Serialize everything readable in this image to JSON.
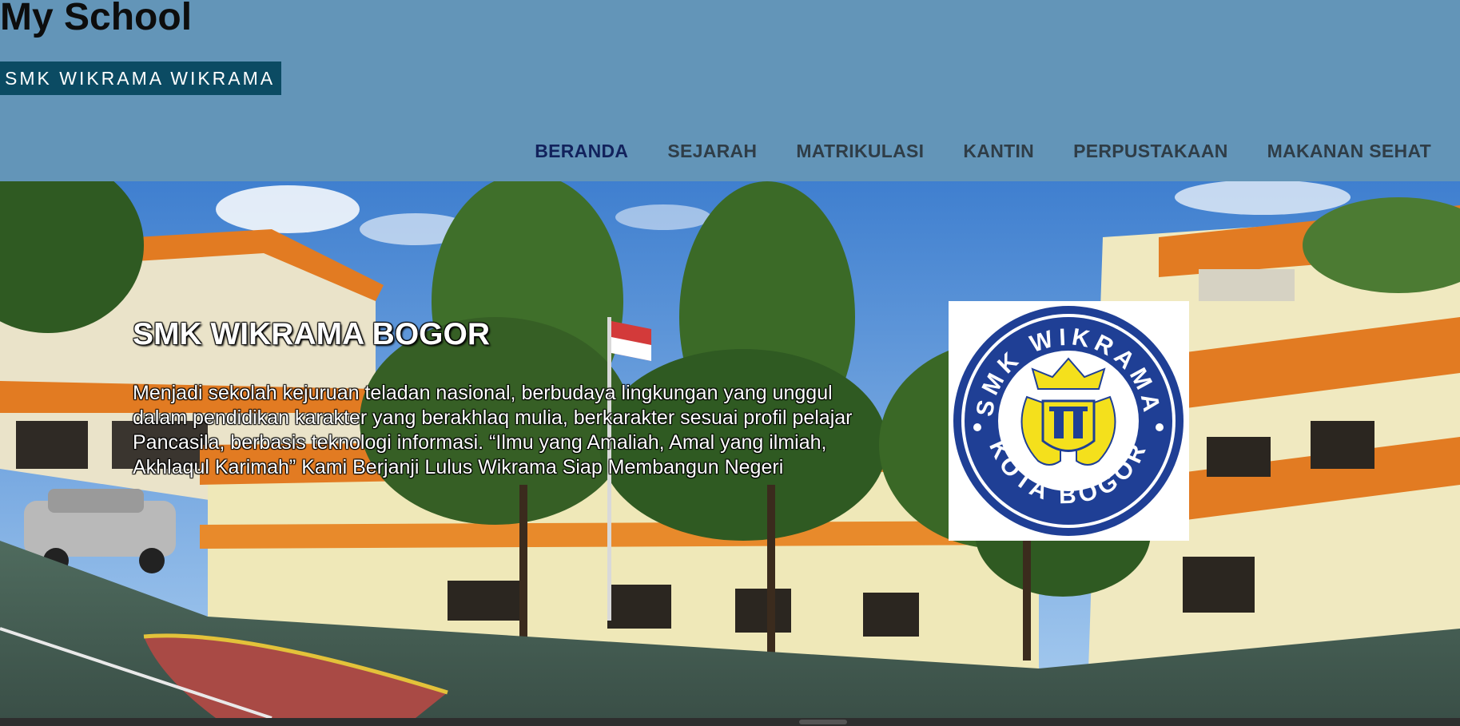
{
  "site": {
    "title": "My School",
    "badge": "SMK WIKRAMA WIKRAMA"
  },
  "nav": {
    "items": [
      {
        "label": "BERANDA",
        "active": true
      },
      {
        "label": "SEJARAH"
      },
      {
        "label": "MATRIKULASI"
      },
      {
        "label": "KANTIN"
      },
      {
        "label": "PERPUSTAKAAN"
      },
      {
        "label": "MAKANAN SEHAT"
      }
    ]
  },
  "hero": {
    "title": "SMK WIKRAMA BOGOR",
    "description": "Menjadi sekolah kejuruan teladan nasional, berbudaya lingkungan yang unggul dalam pendidikan karakter yang berakhlaq mulia, berkarakter sesuai profil pelajar Pancasila, berbasis teknologi informasi. “Ilmu yang Amaliah, Amal yang ilmiah, Akhlaqul Karimah” Kami Berjanji Lulus Wikrama Siap Membangun Negeri",
    "logo": {
      "text_top": "SMK WIKRAMA",
      "text_bottom": "KOTA BOGOR",
      "icon": "school-crest-icon"
    }
  },
  "colors": {
    "header_bg": "#6395b8",
    "badge_bg": "#0b4b63",
    "nav_text": "#2f3d47",
    "nav_active": "#12225c",
    "logo_blue": "#1f3f95",
    "logo_yellow": "#f4e01c"
  }
}
